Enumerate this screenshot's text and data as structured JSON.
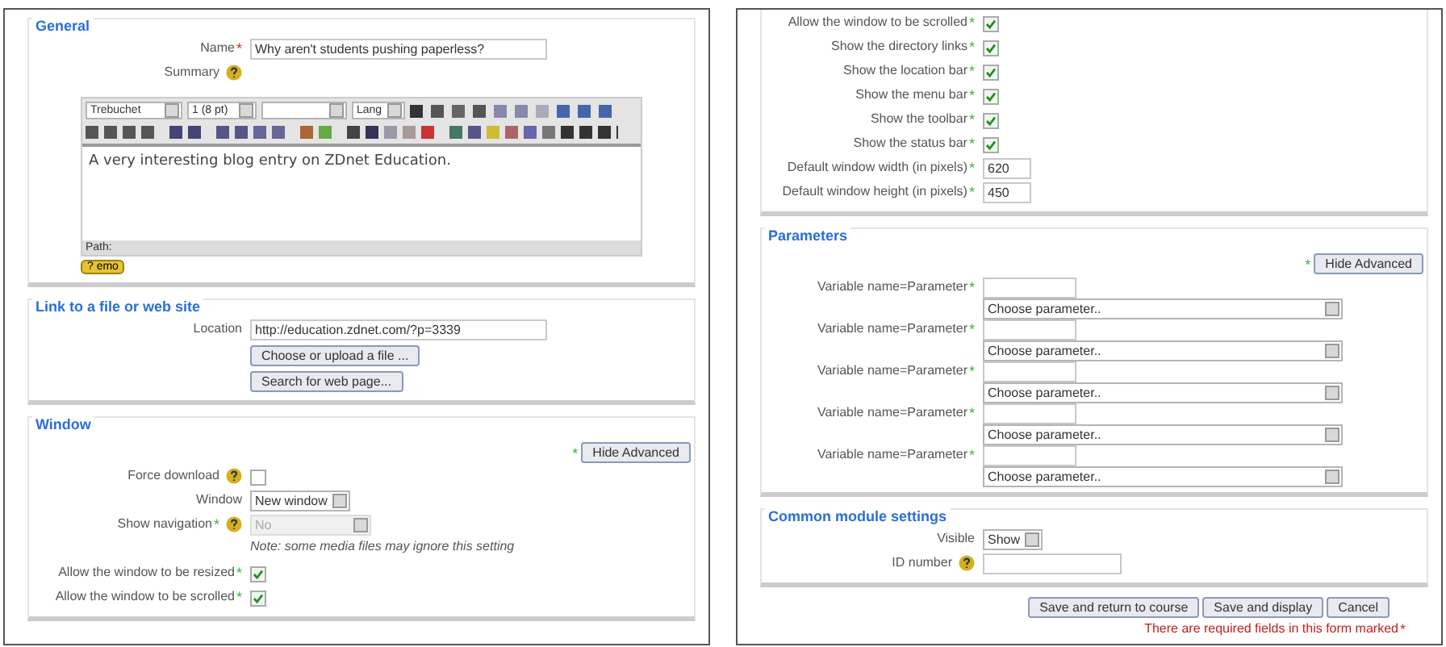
{
  "left": {
    "sections": [
      {
        "legend": "General",
        "rows": [
          {
            "kind": "text",
            "label": "Name",
            "star": "*",
            "required": true,
            "value": "Why aren't students pushing paperless?"
          },
          {
            "kind": "label",
            "label": "Summary",
            "help": true
          },
          {
            "kind": "editor",
            "font": "Trebuchet",
            "size": "1 (8 pt)",
            "lang": "Lang",
            "content": "A very interesting blog entry on ZDnet Education.",
            "path": "Path:",
            "help_button": "? emo"
          }
        ]
      },
      {
        "legend": "Link to a file or web site",
        "rows": [
          {
            "kind": "text",
            "label": "Location",
            "value": "http://education.zdnet.com/?p=3339"
          },
          {
            "kind": "button",
            "label": "Choose or upload a file ..."
          },
          {
            "kind": "button",
            "label": "Search for web page..."
          }
        ]
      },
      {
        "legend": "Window",
        "rows": [
          {
            "kind": "advanced",
            "star": "*",
            "required": false,
            "label": "Hide Advanced"
          },
          {
            "kind": "checkbox",
            "label": "Force download",
            "help": true,
            "checked": false
          },
          {
            "kind": "select",
            "label": "Window",
            "value": "New window",
            "disabled": false
          },
          {
            "kind": "select",
            "label": "Show navigation",
            "star": "*",
            "required": false,
            "help": true,
            "value": "No",
            "disabled": true
          },
          {
            "kind": "note",
            "text": "Note: some media files may ignore this setting"
          },
          {
            "kind": "checkbox",
            "label": "Allow the window to be resized",
            "star": "*",
            "required": false,
            "checked": true
          },
          {
            "kind": "checkbox",
            "label": "Allow the window to be scrolled",
            "star": "*",
            "required": false,
            "checked": true
          }
        ]
      }
    ]
  },
  "right": {
    "sections": [
      {
        "rows": [
          {
            "kind": "checkbox",
            "label": "Allow the window to be scrolled",
            "star": "*",
            "required": false,
            "checked": true
          },
          {
            "kind": "checkbox",
            "label": "Show the directory links",
            "star": "*",
            "required": false,
            "checked": true
          },
          {
            "kind": "checkbox",
            "label": "Show the location bar",
            "star": "*",
            "required": false,
            "checked": true
          },
          {
            "kind": "checkbox",
            "label": "Show the menu bar",
            "star": "*",
            "required": false,
            "checked": true
          },
          {
            "kind": "checkbox",
            "label": "Show the toolbar",
            "star": "*",
            "required": false,
            "checked": true
          },
          {
            "kind": "checkbox",
            "label": "Show the status bar",
            "star": "*",
            "required": false,
            "checked": true
          },
          {
            "kind": "number",
            "label": "Default window width (in pixels)",
            "star": "*",
            "required": false,
            "value": "620"
          },
          {
            "kind": "number",
            "label": "Default window height (in pixels)",
            "star": "*",
            "required": false,
            "value": "450"
          }
        ]
      },
      {
        "legend": "Parameters",
        "rows": [
          {
            "kind": "advanced",
            "star": "*",
            "required": false,
            "label": "Hide Advanced"
          },
          {
            "kind": "param",
            "label": "Variable name=Parameter",
            "star": "*",
            "required": false,
            "select": "Choose parameter.."
          },
          {
            "kind": "param",
            "label": "Variable name=Parameter",
            "star": "*",
            "required": false,
            "select": "Choose parameter.."
          },
          {
            "kind": "param",
            "label": "Variable name=Parameter",
            "star": "*",
            "required": false,
            "select": "Choose parameter.."
          },
          {
            "kind": "param",
            "label": "Variable name=Parameter",
            "star": "*",
            "required": false,
            "select": "Choose parameter.."
          },
          {
            "kind": "param",
            "label": "Variable name=Parameter",
            "star": "*",
            "required": false,
            "select": "Choose parameter.."
          }
        ]
      },
      {
        "legend": "Common module settings",
        "rows": [
          {
            "kind": "select",
            "label": "Visible",
            "value": "Show",
            "disabled": false
          },
          {
            "kind": "short_text",
            "label": "ID number",
            "help": true
          }
        ]
      }
    ],
    "footer": {
      "buttons": [
        "Save and return to course",
        "Save and display",
        "Cancel"
      ],
      "note": "There are required fields in this form marked",
      "star": "*",
      "required": true
    }
  }
}
